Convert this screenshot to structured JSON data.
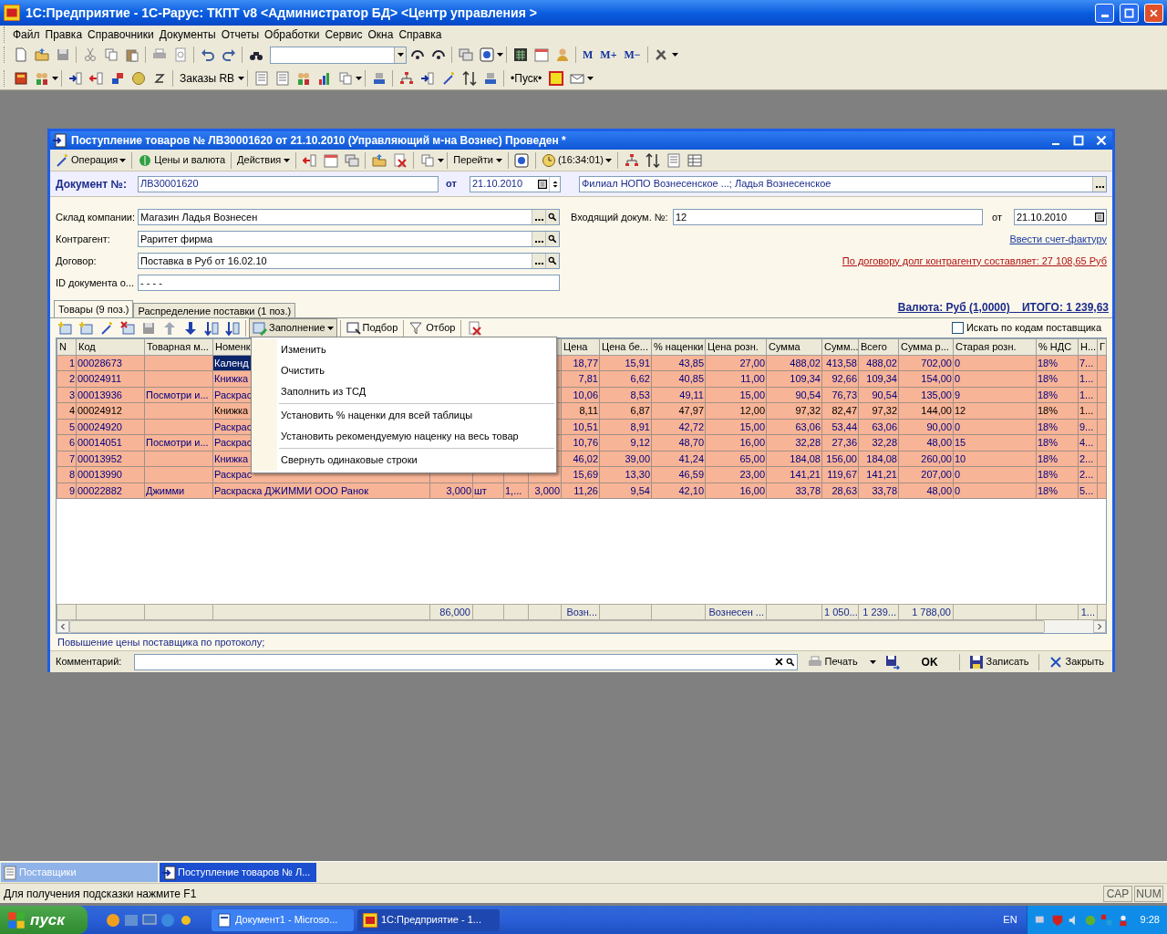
{
  "app_window": {
    "title": "1С:Предприятие - 1С-Рарус: ТКПТ v8 <Администратор БД> <Центр управления >"
  },
  "menu": [
    "Файл",
    "Правка",
    "Справочники",
    "Документы",
    "Отчеты",
    "Обработки",
    "Сервис",
    "Окна",
    "Справка"
  ],
  "toolbar1": {
    "memory_buttons": [
      "M",
      "M+",
      "M−"
    ]
  },
  "toolbar2": {
    "orders_button": "Заказы RB",
    "start_button": "•Пуск•"
  },
  "document": {
    "title": "Поступление товаров № ЛВ30001620 от 21.10.2010 (Управляющий м-на Вознес) Проведен *",
    "toolbar": [
      "Операция",
      "Цены и валюта",
      "Действия",
      "Перейти",
      "(16:34:01)"
    ],
    "number_label": "Документ №:",
    "number": "ЛВ30001620",
    "date_label": "от",
    "date": "21.10.2010",
    "branch": "Филиал НОПО Вознесенское ...; Ладья Вознесенское",
    "fields_left": [
      {
        "label": "Склад компании:",
        "value": "Магазин Ладья Вознесен"
      },
      {
        "label": "Контрагент:",
        "value": "Раритет фирма"
      },
      {
        "label": "Договор:",
        "value": "Поставка в Руб от 16.02.10"
      },
      {
        "label": "ID документа о...",
        "value": "-   -   -   -"
      }
    ],
    "incoming_label": "Входящий докум. №:",
    "incoming_number": "12",
    "incoming_date_label": "от",
    "incoming_date": "21.10.2010",
    "invoice_link": "Ввести счет-фактуру",
    "debt_link": "По договору долг контрагенту составляет: 27 108,65 Руб",
    "tabs": [
      {
        "label": "Товары (9 поз.)",
        "selected": true
      },
      {
        "label": "Распределение поставки (1 поз.)",
        "selected": false
      }
    ],
    "currency_total": "Валюта: Руб (1,0000)    ИТОГО: 1 239,63",
    "table_toolbar": [
      "Заполнение",
      "Подбор",
      "Отбор"
    ],
    "search_by_supplier": {
      "label": "Искать по кодам поставщика",
      "checked": false
    },
    "fill_menu": [
      {
        "kind": "item",
        "label": "Изменить"
      },
      {
        "kind": "item",
        "label": "Очистить"
      },
      {
        "kind": "item",
        "label": "Заполнить из ТСД"
      },
      {
        "kind": "separator"
      },
      {
        "kind": "item",
        "label": "Установить % наценки для всей таблицы"
      },
      {
        "kind": "item",
        "label": "Установить рекомендуемую наценку на весь товар"
      },
      {
        "kind": "separator"
      },
      {
        "kind": "item",
        "label": "Свернуть одинаковые строки"
      }
    ],
    "table": {
      "columns": {
        "column_1": "N",
        "column_2": "Код",
        "column_3": "Товарная м...",
        "column_4": "Номенк",
        "column_9": "Цена",
        "column_10": "Цена бе...",
        "column_11": "% наценки",
        "column_12": "Цена розн.",
        "column_13": "Сумма",
        "column_14": "Сумм...",
        "column_15": "Всего",
        "column_16": "Сумма р...",
        "column_17": "Старая розн.",
        "column_18": "% НДС",
        "column_19": "Н...",
        "column_20": "Г"
      },
      "rows": [
        {
          "selected": true,
          "emphasized": true,
          "cells": {
            "column_1": "1",
            "column_2": "00028673",
            "column_4": "Календ",
            "column_9": "18,77",
            "column_10": "15,91",
            "column_11": "43,85",
            "column_12": "27,00",
            "column_13": "488,02",
            "column_14": "413,58",
            "column_15": "488,02",
            "column_16": "702,00",
            "column_17": "0",
            "column_18": "18%",
            "column_19": "7..."
          }
        },
        {
          "selected": false,
          "emphasized": true,
          "cells": {
            "column_1": "2",
            "column_2": "00024911",
            "column_4": "Книжка",
            "column_9": "7,81",
            "column_10": "6,62",
            "column_11": "40,85",
            "column_12": "11,00",
            "column_13": "109,34",
            "column_14": "92,66",
            "column_15": "109,34",
            "column_16": "154,00",
            "column_17": "0",
            "column_18": "18%",
            "column_19": "1..."
          }
        },
        {
          "selected": false,
          "emphasized": true,
          "cells": {
            "column_1": "3",
            "column_2": "00013936",
            "column_3": "Посмотри и...",
            "column_4": "Раскрас",
            "column_9": "10,06",
            "column_10": "8,53",
            "column_11": "49,11",
            "column_12": "15,00",
            "column_13": "90,54",
            "column_14": "76,73",
            "column_15": "90,54",
            "column_16": "135,00",
            "column_17": "9",
            "column_18": "18%",
            "column_19": "1..."
          }
        },
        {
          "selected": false,
          "emphasized": false,
          "cells": {
            "column_1": "4",
            "column_2": "00024912",
            "column_4": "Книжка",
            "column_9": "8,11",
            "column_10": "6,87",
            "column_11": "47,97",
            "column_12": "12,00",
            "column_13": "97,32",
            "column_14": "82,47",
            "column_15": "97,32",
            "column_16": "144,00",
            "column_17": "12",
            "column_18": "18%",
            "column_19": "1..."
          }
        },
        {
          "selected": false,
          "emphasized": true,
          "cells": {
            "column_1": "5",
            "column_2": "00024920",
            "column_4": "Раскрас",
            "column_9": "10,51",
            "column_10": "8,91",
            "column_11": "42,72",
            "column_12": "15,00",
            "column_13": "63,06",
            "column_14": "53,44",
            "column_15": "63,06",
            "column_16": "90,00",
            "column_17": "0",
            "column_18": "18%",
            "column_19": "9..."
          }
        },
        {
          "selected": false,
          "emphasized": true,
          "cells": {
            "column_1": "6",
            "column_2": "00014051",
            "column_3": "Посмотри и...",
            "column_4": "Раскрас",
            "column_9": "10,76",
            "column_10": "9,12",
            "column_11": "48,70",
            "column_12": "16,00",
            "column_13": "32,28",
            "column_14": "27,36",
            "column_15": "32,28",
            "column_16": "48,00",
            "column_17": "15",
            "column_18": "18%",
            "column_19": "4..."
          }
        },
        {
          "selected": false,
          "emphasized": true,
          "cells": {
            "column_1": "7",
            "column_2": "00013952",
            "column_4": "Книжка",
            "column_9": "46,02",
            "column_10": "39,00",
            "column_11": "41,24",
            "column_12": "65,00",
            "column_13": "184,08",
            "column_14": "156,00",
            "column_15": "184,08",
            "column_16": "260,00",
            "column_17": "10",
            "column_18": "18%",
            "column_19": "2..."
          }
        },
        {
          "selected": false,
          "emphasized": true,
          "cells": {
            "column_1": "8",
            "column_2": "00013990",
            "column_4": "Раскрас",
            "column_9": "15,69",
            "column_10": "13,30",
            "column_11": "46,59",
            "column_12": "23,00",
            "column_13": "141,21",
            "column_14": "119,67",
            "column_15": "141,21",
            "column_16": "207,00",
            "column_17": "0",
            "column_18": "18%",
            "column_19": "2..."
          }
        },
        {
          "selected": false,
          "emphasized": true,
          "cells": {
            "column_1": "9",
            "column_2": "00022882",
            "column_3": "Джимми",
            "column_4": "Раскраска ДЖИММИ ООО Ранок",
            "column_5": "3,000",
            "column_6": "шт",
            "column_7": "1,...",
            "column_8": "3,000",
            "column_9": "11,26",
            "column_10": "9,54",
            "column_11": "42,10",
            "column_12": "16,00",
            "column_13": "33,78",
            "column_14": "28,63",
            "column_15": "33,78",
            "column_16": "48,00",
            "column_17": "0",
            "column_18": "18%",
            "column_19": "5..."
          }
        }
      ],
      "footer": {
        "column_5": "86,000",
        "column_9": "Возн...",
        "column_12": "Вознесен ...",
        "column_14": "1 050...",
        "column_15": "1 239...",
        "column_16": "1 788,00",
        "column_19": "1..."
      }
    },
    "note": "Повышение цены поставщика по протоколу;",
    "comment_label": "Комментарий:",
    "buttons": [
      "Печать",
      "OK",
      "Записать",
      "Закрыть"
    ]
  },
  "window_tabs": [
    {
      "label": "Поставщики",
      "selected": false
    },
    {
      "label": "Поступление товаров № Л...",
      "selected": true
    }
  ],
  "status_bar": {
    "hint": "Для получения подсказки нажмите F1",
    "indicators": [
      "CAP",
      "NUM"
    ]
  },
  "taskbar": {
    "start": "пуск",
    "tasks": [
      {
        "label": "Документ1 - Microso...",
        "selected": false
      },
      {
        "label": "1С:Предприятие - 1...",
        "selected": true
      }
    ],
    "language": "EN",
    "time": "9:28"
  }
}
